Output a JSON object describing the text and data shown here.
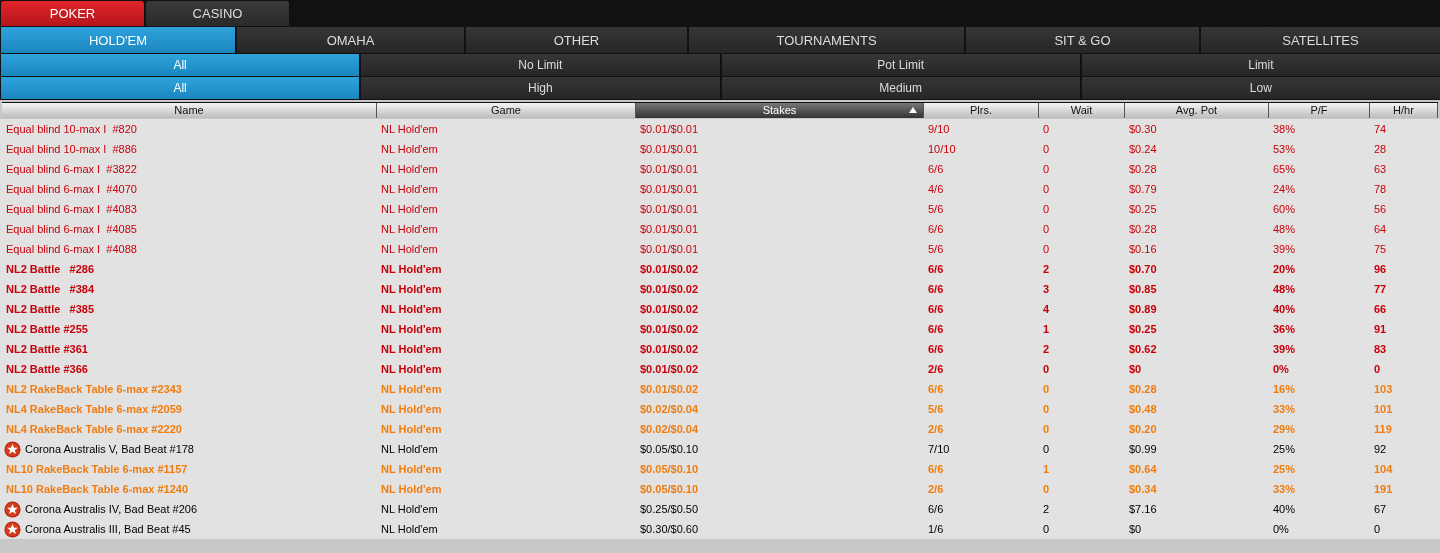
{
  "main_tabs": [
    {
      "label": "POKER",
      "selected": true
    },
    {
      "label": "CASINO",
      "selected": false
    }
  ],
  "game_tabs": [
    {
      "label": "HOLD'EM",
      "selected": true
    },
    {
      "label": "OMAHA",
      "selected": false
    },
    {
      "label": "OTHER",
      "selected": false
    },
    {
      "label": "TOURNAMENTS",
      "selected": false
    },
    {
      "label": "SIT & GO",
      "selected": false
    },
    {
      "label": "SATELLITES",
      "selected": false
    }
  ],
  "limit_filters": [
    {
      "label": "All",
      "selected": true
    },
    {
      "label": "No Limit",
      "selected": false
    },
    {
      "label": "Pot Limit",
      "selected": false
    },
    {
      "label": "Limit",
      "selected": false
    }
  ],
  "stake_filters": [
    {
      "label": "All",
      "selected": true
    },
    {
      "label": "High",
      "selected": false
    },
    {
      "label": "Medium",
      "selected": false
    },
    {
      "label": "Low",
      "selected": false
    }
  ],
  "table": {
    "columns": [
      {
        "label": "Name",
        "sorted": false
      },
      {
        "label": "Game",
        "sorted": false
      },
      {
        "label": "Stakes",
        "sorted": true
      },
      {
        "label": "Plrs.",
        "sorted": false
      },
      {
        "label": "Wait",
        "sorted": false
      },
      {
        "label": "Avg. Pot",
        "sorted": false
      },
      {
        "label": "P/F",
        "sorted": false
      },
      {
        "label": "H/hr",
        "sorted": false
      }
    ],
    "rows": [
      {
        "kind": "equal",
        "cells": [
          "Equal blind 10-max I  #820",
          "NL Hold'em",
          "$0.01/$0.01",
          "9/10",
          "0",
          "$0.30",
          "38%",
          "74"
        ]
      },
      {
        "kind": "equal",
        "cells": [
          "Equal blind 10-max I  #886",
          "NL Hold'em",
          "$0.01/$0.01",
          "10/10",
          "0",
          "$0.24",
          "53%",
          "28"
        ]
      },
      {
        "kind": "equal",
        "cells": [
          "Equal blind 6-max I  #3822",
          "NL Hold'em",
          "$0.01/$0.01",
          "6/6",
          "0",
          "$0.28",
          "65%",
          "63"
        ]
      },
      {
        "kind": "equal",
        "cells": [
          "Equal blind 6-max I  #4070",
          "NL Hold'em",
          "$0.01/$0.01",
          "4/6",
          "0",
          "$0.79",
          "24%",
          "78"
        ]
      },
      {
        "kind": "equal",
        "cells": [
          "Equal blind 6-max I  #4083",
          "NL Hold'em",
          "$0.01/$0.01",
          "5/6",
          "0",
          "$0.25",
          "60%",
          "56"
        ]
      },
      {
        "kind": "equal",
        "cells": [
          "Equal blind 6-max I  #4085",
          "NL Hold'em",
          "$0.01/$0.01",
          "6/6",
          "0",
          "$0.28",
          "48%",
          "64"
        ]
      },
      {
        "kind": "equal",
        "cells": [
          "Equal blind 6-max I  #4088",
          "NL Hold'em",
          "$0.01/$0.01",
          "5/6",
          "0",
          "$0.16",
          "39%",
          "75"
        ]
      },
      {
        "kind": "battle",
        "cells": [
          "NL2 Battle   #286",
          "NL Hold'em",
          "$0.01/$0.02",
          "6/6",
          "2",
          "$0.70",
          "20%",
          "96"
        ]
      },
      {
        "kind": "battle",
        "cells": [
          "NL2 Battle   #384",
          "NL Hold'em",
          "$0.01/$0.02",
          "6/6",
          "3",
          "$0.85",
          "48%",
          "77"
        ]
      },
      {
        "kind": "battle",
        "cells": [
          "NL2 Battle   #385",
          "NL Hold'em",
          "$0.01/$0.02",
          "6/6",
          "4",
          "$0.89",
          "40%",
          "66"
        ]
      },
      {
        "kind": "battle",
        "cells": [
          "NL2 Battle #255",
          "NL Hold'em",
          "$0.01/$0.02",
          "6/6",
          "1",
          "$0.25",
          "36%",
          "91"
        ]
      },
      {
        "kind": "battle",
        "cells": [
          "NL2 Battle #361",
          "NL Hold'em",
          "$0.01/$0.02",
          "6/6",
          "2",
          "$0.62",
          "39%",
          "83"
        ]
      },
      {
        "kind": "battle",
        "cells": [
          "NL2 Battle #366",
          "NL Hold'em",
          "$0.01/$0.02",
          "2/6",
          "0",
          "$0",
          "0%",
          "0"
        ]
      },
      {
        "kind": "rakeback",
        "cells": [
          "NL2 RakeBack Table 6-max #2343",
          "NL Hold'em",
          "$0.01/$0.02",
          "6/6",
          "0",
          "$0.28",
          "16%",
          "103"
        ]
      },
      {
        "kind": "rakeback",
        "cells": [
          "NL4 RakeBack Table 6-max #2059",
          "NL Hold'em",
          "$0.02/$0.04",
          "5/6",
          "0",
          "$0.48",
          "33%",
          "101"
        ]
      },
      {
        "kind": "rakeback",
        "cells": [
          "NL4 RakeBack Table 6-max #2220",
          "NL Hold'em",
          "$0.02/$0.04",
          "2/6",
          "0",
          "$0.20",
          "29%",
          "119"
        ]
      },
      {
        "kind": "jackpot",
        "cells": [
          "Corona Australis V, Bad Beat #178",
          "NL Hold'em",
          "$0.05/$0.10",
          "7/10",
          "0",
          "$0.99",
          "25%",
          "92"
        ]
      },
      {
        "kind": "rakeback",
        "cells": [
          "NL10 RakeBack Table 6-max #1157",
          "NL Hold'em",
          "$0.05/$0.10",
          "6/6",
          "1",
          "$0.64",
          "25%",
          "104"
        ]
      },
      {
        "kind": "rakeback",
        "cells": [
          "NL10 RakeBack Table 6-max #1240",
          "NL Hold'em",
          "$0.05/$0.10",
          "2/6",
          "0",
          "$0.34",
          "33%",
          "191"
        ]
      },
      {
        "kind": "jackpot",
        "cells": [
          "Corona Australis IV, Bad Beat #206",
          "NL Hold'em",
          "$0.25/$0.50",
          "6/6",
          "2",
          "$7.16",
          "40%",
          "67"
        ]
      },
      {
        "kind": "jackpot",
        "cells": [
          "Corona Australis III, Bad Beat #45",
          "NL Hold'em",
          "$0.30/$0.60",
          "1/6",
          "0",
          "$0",
          "0%",
          "0"
        ]
      }
    ]
  }
}
